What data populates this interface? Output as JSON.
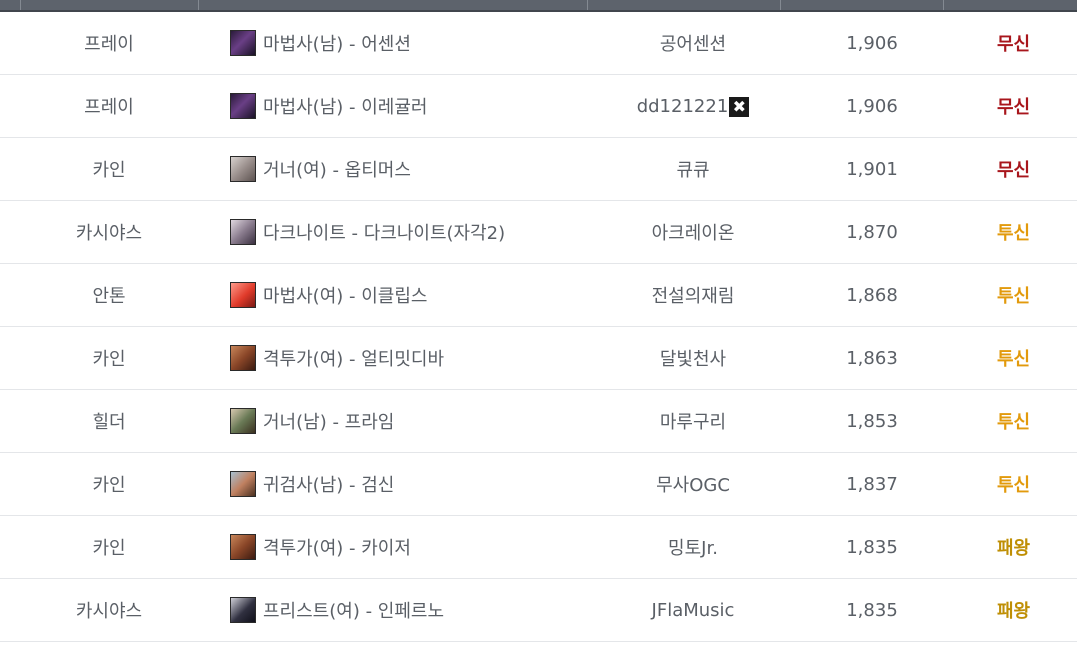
{
  "colors": {
    "grade_musin": "#a8161c",
    "grade_tusin": "#e29a0c",
    "grade_paewang": "#bf8f05"
  },
  "rows": [
    {
      "server": "프레이",
      "job_icon": "mage-m",
      "job": "마법사(남) - 어센션",
      "name": "공어센션",
      "score": "1,906",
      "grade": "무신",
      "grade_color": "#a8161c"
    },
    {
      "server": "프레이",
      "job_icon": "mage-m",
      "job": "마법사(남) - 이레귤러",
      "name": "dd121221",
      "name_icon": "crossed-swords-icon",
      "score": "1,906",
      "grade": "무신",
      "grade_color": "#a8161c"
    },
    {
      "server": "카인",
      "job_icon": "gunner-f",
      "job": "거너(여) - 옵티머스",
      "name": "큐큐",
      "score": "1,901",
      "grade": "무신",
      "grade_color": "#a8161c"
    },
    {
      "server": "카시야스",
      "job_icon": "darkknight",
      "job": "다크나이트 - 다크나이트(자각2)",
      "name": "아크레이온",
      "score": "1,870",
      "grade": "투신",
      "grade_color": "#e29a0c"
    },
    {
      "server": "안톤",
      "job_icon": "mage-f",
      "job": "마법사(여) - 이클립스",
      "name": "전설의재림",
      "score": "1,868",
      "grade": "투신",
      "grade_color": "#e29a0c"
    },
    {
      "server": "카인",
      "job_icon": "fighter-f",
      "job": "격투가(여) - 얼티밋디바",
      "name": "달빛천사",
      "score": "1,863",
      "grade": "투신",
      "grade_color": "#e29a0c"
    },
    {
      "server": "힐더",
      "job_icon": "gunner-m",
      "job": "거너(남) - 프라임",
      "name": "마루구리",
      "score": "1,853",
      "grade": "투신",
      "grade_color": "#e29a0c"
    },
    {
      "server": "카인",
      "job_icon": "slayer-m",
      "job": "귀검사(남) - 검신",
      "name": "무사OGC",
      "score": "1,837",
      "grade": "투신",
      "grade_color": "#e29a0c"
    },
    {
      "server": "카인",
      "job_icon": "fighter-f",
      "job": "격투가(여) - 카이저",
      "name": "밍토Jr.",
      "score": "1,835",
      "grade": "패왕",
      "grade_color": "#bf8f05"
    },
    {
      "server": "카시야스",
      "job_icon": "priest-f",
      "job": "프리스트(여) - 인페르노",
      "name": "JFlaMusic",
      "score": "1,835",
      "grade": "패왕",
      "grade_color": "#bf8f05"
    }
  ]
}
